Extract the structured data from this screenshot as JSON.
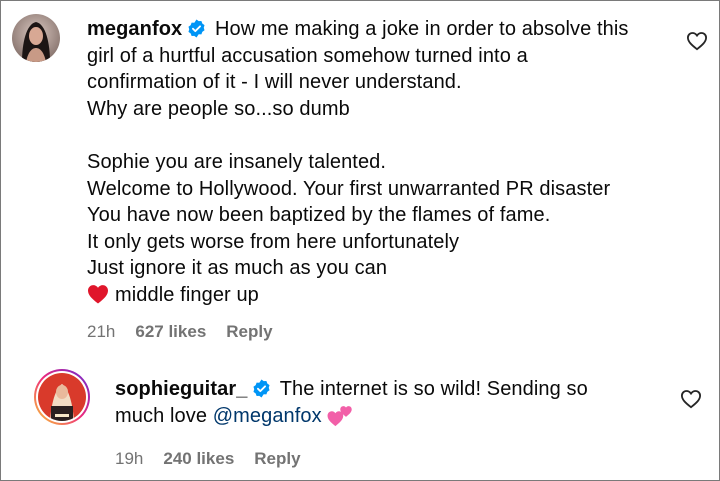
{
  "comments": [
    {
      "username": "meganfox",
      "text_lines": [
        "How me making a joke in order to absolve this",
        "girl of a hurtful accusation somehow turned into a",
        "confirmation of it - I will never understand.",
        "Why are people so...so dumb",
        "",
        "Sophie you are insanely talented.",
        "Welcome to Hollywood. Your first unwarranted PR disaster",
        "You have now been baptized by the flames of fame.",
        "It only gets worse from here unfortunately",
        "Just ignore it as much as you can",
        "middle finger up"
      ],
      "time": "21h",
      "likes": "627 likes",
      "reply_label": "Reply"
    },
    {
      "username": "sophieguitar_",
      "text_line1": "The internet is so wild! Sending so",
      "text_line2_prefix": "much love ",
      "mention": "@meganfox",
      "time": "19h",
      "likes": "240 likes",
      "reply_label": "Reply"
    }
  ],
  "icons": {
    "verified": "verified-badge-icon",
    "like": "heart-outline-icon",
    "emoji_red_heart": "red-heart-emoji",
    "emoji_two_hearts": "two-hearts-emoji"
  },
  "colors": {
    "verified_blue": "#0095f6",
    "meta_gray": "#737373",
    "mention_blue": "#00376b",
    "story_ring_start": "#f9ce34",
    "story_ring_mid": "#ee2a7b",
    "story_ring_end": "#6228d7"
  }
}
